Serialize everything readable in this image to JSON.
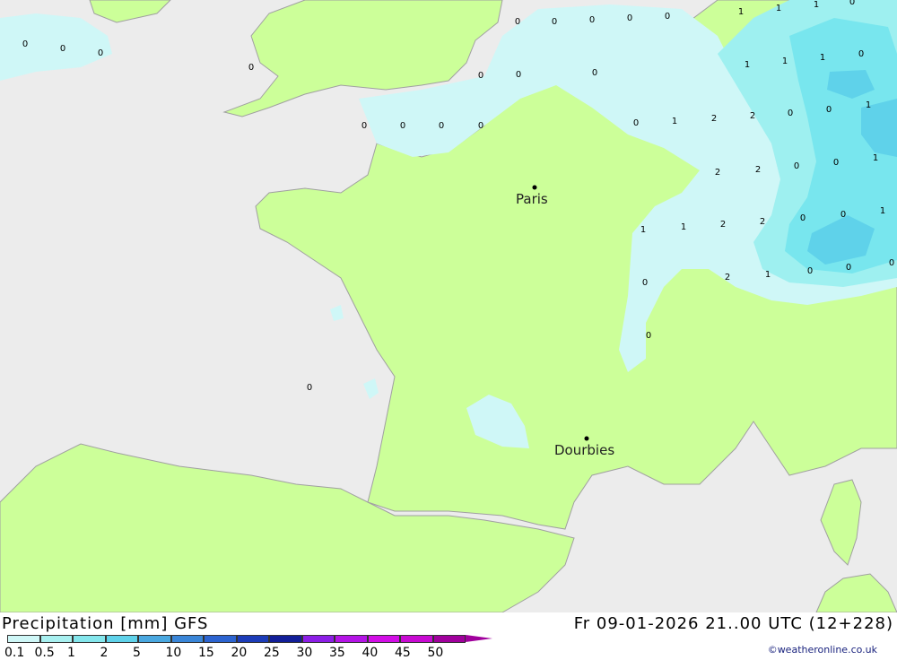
{
  "map": {
    "cities": [
      {
        "id": "paris",
        "name": "Paris"
      },
      {
        "id": "dourbies",
        "name": "Dourbies"
      }
    ],
    "values": [
      "0",
      "0",
      "0",
      "0",
      "0",
      "0",
      "0",
      "0",
      "0",
      "1",
      "1",
      "1",
      "0",
      "1",
      "1",
      "1",
      "0",
      "0",
      "0",
      "0",
      "0",
      "0",
      "0",
      "0",
      "0",
      "1",
      "2",
      "2",
      "0",
      "0",
      "1",
      "2",
      "2",
      "0",
      "0",
      "1",
      "1",
      "1",
      "2",
      "2",
      "0",
      "0",
      "1",
      "2",
      "1",
      "0",
      "0",
      "0",
      "0",
      "0",
      "0"
    ],
    "colors": {
      "sea": "#ececec",
      "land": "#ccff99",
      "border": "#a0a0a0",
      "precip_light": "#cff7f7",
      "precip_1": "#9ef0f0",
      "precip_2": "#78e6ee",
      "precip_5": "#5fd2ea"
    }
  },
  "footer": {
    "title": "Precipitation [mm] GFS",
    "datetime": "Fr 09-01-2026 21..00 UTC (12+228)",
    "credit": "©weatheronline.co.uk"
  },
  "legend": {
    "ticks": [
      "0.1",
      "0.5",
      "1",
      "2",
      "5",
      "10",
      "15",
      "20",
      "25",
      "30",
      "35",
      "40",
      "45",
      "50"
    ],
    "colors": [
      "#cff7f7",
      "#a8f0f0",
      "#84e6ec",
      "#5fd2ea",
      "#4aa8e0",
      "#3a86d8",
      "#2c64d0",
      "#1c3cb8",
      "#121e98",
      "#8c1ee6",
      "#b414e6",
      "#d20ee6",
      "#c80ad2",
      "#a0009c"
    ]
  }
}
